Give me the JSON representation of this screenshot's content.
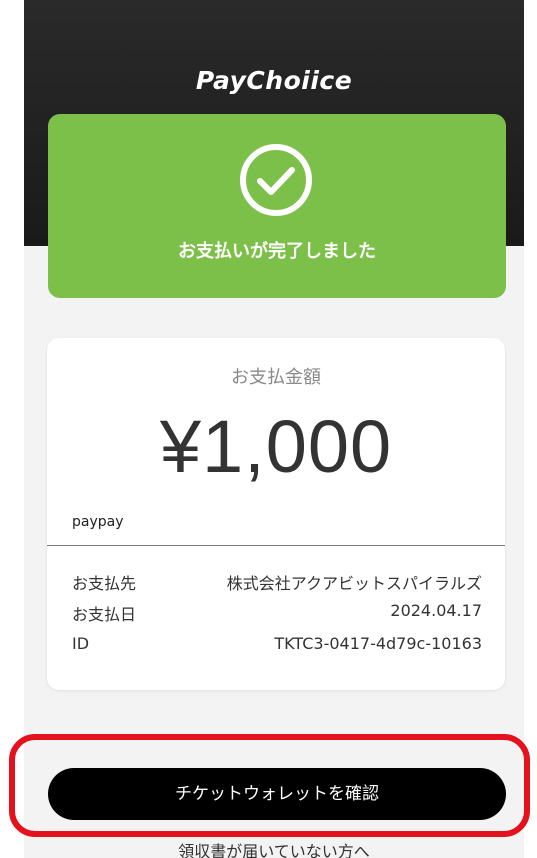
{
  "app": {
    "brand": "PayChoiice"
  },
  "status": {
    "message": "お支払いが完了しました",
    "icon": "check-circle-icon",
    "color": "#7cc04a"
  },
  "payment": {
    "amount_label": "お支払金額",
    "amount": "¥1,000",
    "method": "paypay",
    "details": [
      {
        "key": "お支払先",
        "value": "株式会社アクアビットスパイラルズ"
      },
      {
        "key": "お支払日",
        "value": "2024.04.17"
      },
      {
        "key": "ID",
        "value": "TKTC3-0417-4d79c-10163"
      }
    ]
  },
  "actions": {
    "confirm_wallet": "チケットウォレットを確認",
    "receipt_link": "領収書が届いていない方へ"
  },
  "highlight_color": "#e3121c"
}
